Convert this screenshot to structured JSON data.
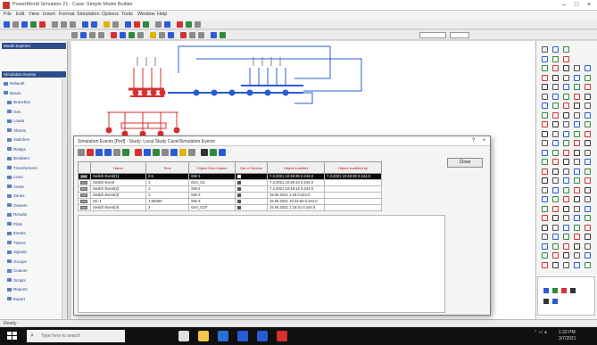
{
  "window": {
    "title": "PowerWorld Simulator 21 - Case: Simple Model Builder",
    "controls": [
      "–",
      "□",
      "×"
    ]
  },
  "menu": [
    "File",
    "Edit",
    "View",
    "Insert",
    "Format",
    "Simulation",
    "Options",
    "Tools",
    "Window",
    "Help"
  ],
  "toolbar_colors": {
    "blue": "#2a5bd7",
    "red": "#d63030",
    "green": "#2e8b3a",
    "gray": "#8a8a8a",
    "yellow": "#e0b400"
  },
  "left_panel": {
    "header_1": "Model Explorer",
    "header_2": "Simulation Events",
    "tree": [
      "Network",
      "Buses",
      "Branches",
      "Gen",
      "Loads",
      "Shunts",
      "Switches",
      "Relays",
      "Breakers",
      "Transformers",
      "Lines",
      "Areas",
      "Zones",
      "Owners",
      "Results",
      "Plots",
      "Events",
      "Timers",
      "Signals",
      "Groups",
      "Custom",
      "Scripts",
      "Reports",
      "Export"
    ]
  },
  "dialog": {
    "title": "Simulation Events [Perf] - Study: Local Study Case/Simulation Events",
    "close_label": "Close",
    "columns": [
      "",
      "Name",
      "Time",
      "Object Short Name",
      "Out of Service",
      "Object modified",
      "Object modified by"
    ],
    "rows": [
      {
        "name": "Switch Event(1)",
        "time": "0.5",
        "object": "SW-1",
        "modified": "7.3.2021 10:49:39 0.244.0",
        "by": "7.3.2021 10:49:39 0.244.0",
        "selected": true
      },
      {
        "name": "Switch Event",
        "time": "1",
        "object": "Gen_G1",
        "modified": "7.3.2021 10:49:13 0.244.0",
        "by": "",
        "selected": false
      },
      {
        "name": "Switch Event(2)",
        "time": "1",
        "object": "SW-2",
        "modified": "7.3.2021 10:49:13 0.244.0",
        "by": "",
        "selected": false
      },
      {
        "name": "Switch Event(3)",
        "time": "1",
        "object": "SW-3",
        "modified": "15.05.2021 1:18 0.244.0",
        "by": "",
        "selected": false
      },
      {
        "name": "SC-1",
        "time": "1.5E050",
        "object": "SW-3",
        "modified": "15.05.2021 10:44:56 0.244.0",
        "by": "",
        "selected": false
      },
      {
        "name": "Switch Event(4)",
        "time": "2",
        "object": "Gen_G1F",
        "modified": "15.05.2021 1:18:41 0.244.0",
        "by": "",
        "selected": false
      }
    ]
  },
  "taskbar": {
    "search_placeholder": "Type here to search",
    "clock": "1:32 PM",
    "date": "3/7/2021"
  },
  "status": {
    "text": "Ready"
  }
}
